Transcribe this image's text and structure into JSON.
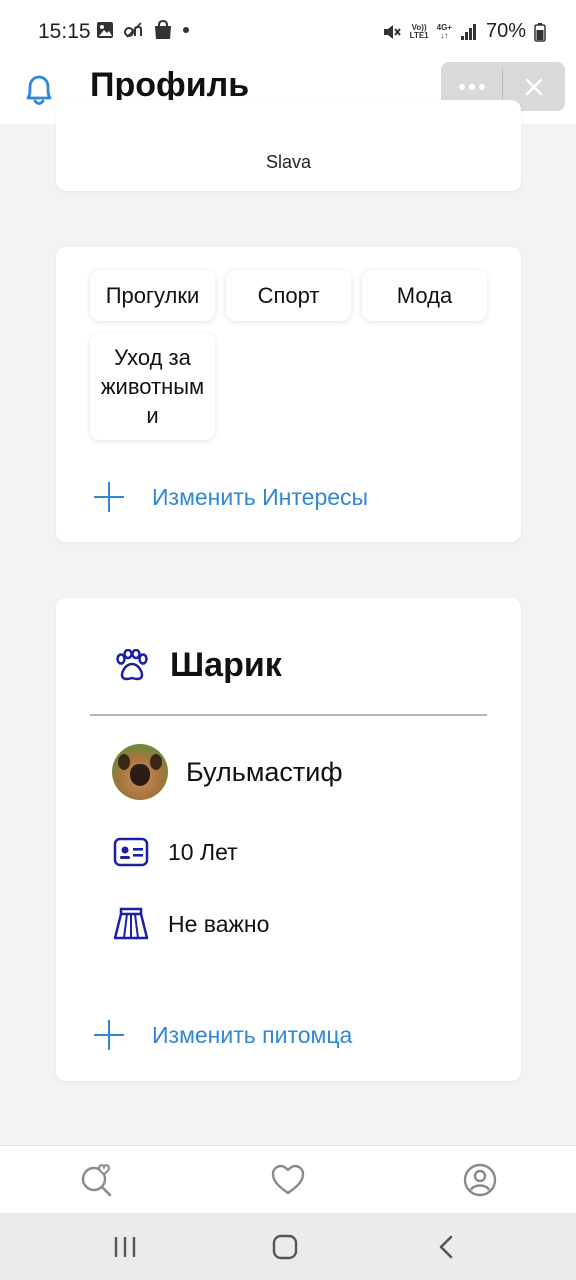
{
  "status_bar": {
    "time": "15:15",
    "left_icons": [
      "image-icon",
      "sim-no-service-icon",
      "shopping-bag-icon",
      "notification-dot-icon"
    ],
    "right_icons": [
      "mute-icon",
      "volte-icon",
      "4g-icon",
      "signal-icon",
      "battery-icon"
    ],
    "volte_label_1": "Vo))",
    "volte_label_2": "LTE1",
    "net_label_1": "4G+",
    "net_label_2": "↓↑",
    "battery": "70%"
  },
  "header": {
    "title": "Профиль",
    "bell_icon": "bell-icon",
    "more_icon": "more-dots-icon",
    "close_icon": "close-icon"
  },
  "owner": {
    "name": "Slava"
  },
  "interests": {
    "chips": [
      "Прогулки",
      "Спорт",
      "Мода",
      "Уход за животным и"
    ],
    "chip_lines": [
      "Уход за",
      "животным",
      "и"
    ],
    "edit_label": "Изменить Интересы"
  },
  "pet": {
    "icon": "paw-icon",
    "name": "Шарик",
    "breed": "Бульмастиф",
    "age": "10 Лет",
    "gender": "Не важно",
    "edit_label": "Изменить питомца"
  },
  "bottom_nav": [
    "search-heart-icon",
    "heart-icon",
    "profile-icon"
  ],
  "system_nav": [
    "recent-apps-icon",
    "home-icon",
    "back-icon"
  ],
  "colors": {
    "accent": "#2f87d6",
    "pet_icon": "#1c1fa8",
    "background": "#f2f3f5"
  }
}
